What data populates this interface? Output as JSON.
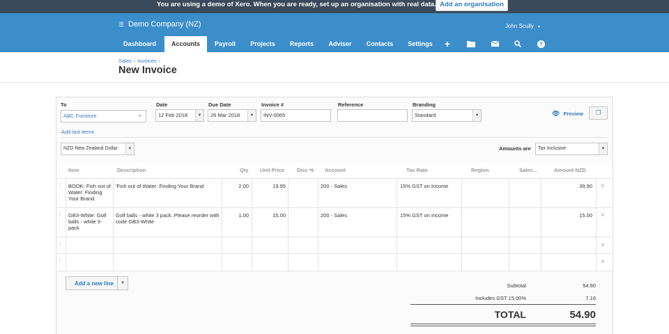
{
  "demo_bar": {
    "message": "You are using a demo of Xero. When you are ready, set up an organisation with real data.",
    "add_org_button": "Add an organisation"
  },
  "header": {
    "org_name": "Demo Company (NZ)",
    "user_name": "John Scully",
    "nav": [
      "Dashboard",
      "Accounts",
      "Payroll",
      "Projects",
      "Reports",
      "Adviser",
      "Contacts",
      "Settings"
    ],
    "active_nav": "Accounts",
    "icons": [
      "plus-icon",
      "folder-icon",
      "mail-icon",
      "search-icon",
      "help-icon"
    ]
  },
  "breadcrumb": [
    "Sales",
    "Invoices"
  ],
  "page_title": "New Invoice",
  "form": {
    "to_label": "To",
    "to_value": "ABC Furniture",
    "date_label": "Date",
    "date_value": "12 Feb 2018",
    "due_label": "Due Date",
    "due_value": "26 Mar 2018",
    "invoice_label": "Invoice #",
    "invoice_value": "INV-0065",
    "reference_label": "Reference",
    "reference_value": "",
    "branding_label": "Branding",
    "branding_value": "Standard",
    "preview_label": "Preview",
    "add_last_items": "Add last items",
    "currency_value": "NZD New Zealand Dollar",
    "amounts_are_label": "Amounts are",
    "amounts_are_value": "Tax Inclusive"
  },
  "table": {
    "columns": [
      "Item",
      "Description",
      "Qty",
      "Unit Price",
      "Disc %",
      "Account",
      "Tax Rate",
      "Region",
      "Sales...",
      "Amount NZD"
    ],
    "rows": [
      {
        "item": "BOOK: Fish out of Water: Finding Your Brand",
        "description": "'Fish out of Water: Finding Your Brand",
        "qty": "2.00",
        "unit_price": "19.95",
        "disc": "",
        "account": "200 - Sales",
        "tax_rate": "15% GST on Income",
        "region": "",
        "sales": "",
        "amount": "39.90"
      },
      {
        "item": "GB3-White: Golf balls - white 3-pack",
        "description": "Golf balls - white 3 pack. Please reorder with code GB3-White",
        "qty": "1.00",
        "unit_price": "15.00",
        "disc": "",
        "account": "200 - Sales",
        "tax_rate": "15% GST on Income",
        "region": "",
        "sales": "",
        "amount": "15.00"
      }
    ]
  },
  "add_line_button": "Add a new line",
  "totals": {
    "subtotal_label": "Subtotal",
    "subtotal_value": "54.90",
    "gst_label": "Includes GST 15.00%",
    "gst_value": "7.16",
    "total_label": "TOTAL",
    "total_value": "54.90"
  },
  "colors": {
    "header_blue": "#3c8ecb",
    "demo_bar": "#3a4a5a",
    "link_blue": "#2f7ac5"
  }
}
